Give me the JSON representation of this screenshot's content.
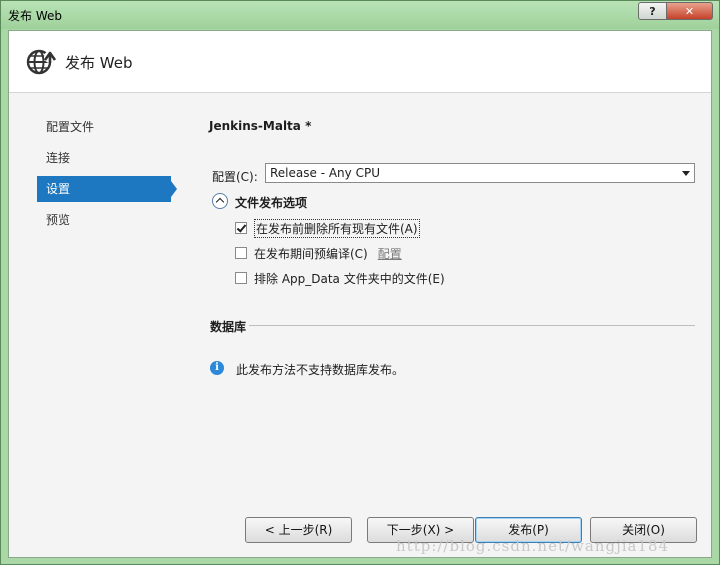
{
  "window": {
    "title": "发布 Web",
    "help_label": "?",
    "close_label": "✕"
  },
  "header": {
    "icon": "globe-publish-icon",
    "title": "发布 Web"
  },
  "nav": {
    "items": [
      {
        "label": "配置文件",
        "active": false
      },
      {
        "label": "连接",
        "active": false
      },
      {
        "label": "设置",
        "active": true
      },
      {
        "label": "预览",
        "active": false
      }
    ]
  },
  "settings": {
    "profile_name": "Jenkins-Malta *",
    "config_label": "配置(C):",
    "config_value": "Release - Any CPU",
    "file_options_label": "文件发布选项",
    "options": [
      {
        "label": "在发布前删除所有现有文件(A)",
        "checked": true
      },
      {
        "label": "在发布期间预编译(C)",
        "checked": false,
        "link": "配置"
      },
      {
        "label": "排除 App_Data 文件夹中的文件(E)",
        "checked": false
      }
    ],
    "database_label": "数据库",
    "database_info": "此发布方法不支持数据库发布。"
  },
  "buttons": {
    "prev": "< 上一步(R)",
    "next": "下一步(X) >",
    "publish": "发布(P)",
    "close": "关闭(O)"
  },
  "watermark": "http://blog.csdn.net/wangjia184",
  "colors": {
    "accent": "#1d78c1",
    "frame": "#a9d8a6",
    "close_button": "#c7422b"
  }
}
